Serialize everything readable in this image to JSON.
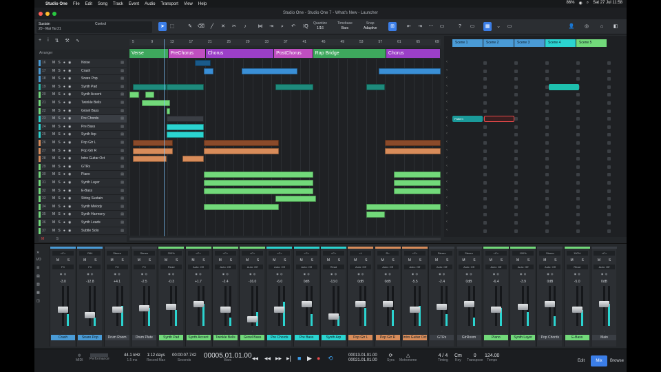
{
  "menubar": {
    "app": "Studio One",
    "items": [
      "File",
      "Edit",
      "Song",
      "Track",
      "Event",
      "Audio",
      "Transport",
      "View",
      "Help"
    ],
    "battery": "86%",
    "clock": "Sat 27 Jul 11:58"
  },
  "window_title": "Studio One - Studio One 7 - What's New - Launcher",
  "toolbar": {
    "preset": "Sustain",
    "preset_sub": "20 - Mai Tai 21",
    "control": "Control",
    "quantize_lbl": "Quantize",
    "quantize": "1/16",
    "timebase_lbl": "Timebase",
    "timebase": "Bars",
    "snap_lbl": "Snap",
    "snap": "Adaptive"
  },
  "arranger_label": "Arranger",
  "ruler": [
    "5",
    "9",
    "13",
    "17",
    "21",
    "25",
    "29",
    "33",
    "37",
    "41",
    "45",
    "49",
    "53",
    "57",
    "61",
    "65",
    "69"
  ],
  "sections": [
    {
      "name": "Verse",
      "color": "#3ea85d",
      "start": 0,
      "end": 12.5
    },
    {
      "name": "PreChorus",
      "color": "#c04fc0",
      "start": 12.5,
      "end": 24.5
    },
    {
      "name": "Chorus",
      "color": "#9b3fc7",
      "start": 24.5,
      "end": 46.5
    },
    {
      "name": "PostChorus",
      "color": "#c04fc0",
      "start": 46.5,
      "end": 59
    },
    {
      "name": "Rap Bridge",
      "color": "#3ea85d",
      "start": 59,
      "end": 82.5
    },
    {
      "name": "Chorus",
      "color": "#9b3fc7",
      "start": 82.5,
      "end": 100
    }
  ],
  "tracks": [
    {
      "n": "16",
      "name": "Noise",
      "color": "#4a9bd6"
    },
    {
      "n": "17",
      "name": "Crash",
      "color": "#4a9bd6"
    },
    {
      "n": "18",
      "name": "Snare Pop",
      "color": "#4a9bd6"
    },
    {
      "n": "19",
      "name": "Synth Pad",
      "color": "#2cb6a2"
    },
    {
      "n": "20",
      "name": "Synth Accent",
      "color": "#72d97a"
    },
    {
      "n": "21",
      "name": "Twinkle Bells",
      "color": "#72d97a"
    },
    {
      "n": "22",
      "name": "Growl Bass",
      "color": "#72d97a"
    },
    {
      "n": "23",
      "name": "Pre Chords",
      "color": "#2bd4d0"
    },
    {
      "n": "24",
      "name": "Pre Bass",
      "color": "#2bd4d0"
    },
    {
      "n": "25",
      "name": "Synth Arp",
      "color": "#2bd4d0"
    },
    {
      "n": "26",
      "name": "Pop Gtr L",
      "color": "#d88c5a"
    },
    {
      "n": "27",
      "name": "Pop Gtr R",
      "color": "#d88c5a"
    },
    {
      "n": "28",
      "name": "Intro Guitar Oct",
      "color": "#d88c5a"
    },
    {
      "n": "29",
      "name": "GTRs",
      "color": "#72d97a"
    },
    {
      "n": "30",
      "name": "Piano",
      "color": "#72d97a"
    },
    {
      "n": "31",
      "name": "Synth Layer",
      "color": "#72d97a"
    },
    {
      "n": "32",
      "name": "E-Bass",
      "color": "#72d97a"
    },
    {
      "n": "33",
      "name": "String Sustain",
      "color": "#72d97a"
    },
    {
      "n": "34",
      "name": "Synth Melody",
      "color": "#72d97a"
    },
    {
      "n": "35",
      "name": "Synth Harmony",
      "color": "#72d97a"
    },
    {
      "n": "36",
      "name": "Synth Leads",
      "color": "#72d97a"
    },
    {
      "n": "37",
      "name": "Subtle Solo",
      "color": "#72d97a"
    }
  ],
  "scenes": [
    {
      "name": "Scene 1",
      "color": "#4a9bd6"
    },
    {
      "name": "Scene 2",
      "color": "#4a9bd6"
    },
    {
      "name": "Scene 3",
      "color": "#4a9bd6"
    },
    {
      "name": "Scene 4",
      "color": "#2bd4d0"
    },
    {
      "name": "Scene 5",
      "color": "#72d97a"
    }
  ],
  "launcher_clip": "Pattern",
  "channels": [
    {
      "name": "Crash",
      "color": "#4a9bd6",
      "vol": "-3.0",
      "pan": "<C>",
      "route": "FX"
    },
    {
      "name": "Snare Pop",
      "color": "#4a9bd6",
      "vol": "-12.8",
      "pan": "R64",
      "route": "FX"
    },
    {
      "name": "Drum Room",
      "color": "#2c2f33",
      "vol": "+4.1",
      "pan": "Stereo",
      "route": "FX"
    },
    {
      "name": "Drum Plate",
      "color": "#2c2f33",
      "vol": "-2.5",
      "pan": "Stereo",
      "route": "FX"
    },
    {
      "name": "Synth Pad",
      "color": "#72d97a",
      "vol": "-0.3",
      "pan": "200%",
      "route": "Read"
    },
    {
      "name": "Synth Accent",
      "color": "#72d97a",
      "vol": "+1.7",
      "pan": "<C>",
      "route": "Auto: Off"
    },
    {
      "name": "Twinkle Bells",
      "color": "#72d97a",
      "vol": "-2.4",
      "pan": "<C>",
      "route": "Auto: Off"
    },
    {
      "name": "Growl Bass",
      "color": "#72d97a",
      "vol": "-16.0",
      "pan": "<C>",
      "route": "Auto: Off"
    },
    {
      "name": "Pre Chords",
      "color": "#2bd4d0",
      "vol": "-6.0",
      "pan": "<C>",
      "route": "Auto: Off"
    },
    {
      "name": "Pre Bass",
      "color": "#2bd4d0",
      "vol": "0dB",
      "pan": "<C>",
      "route": "Auto: Off"
    },
    {
      "name": "Synth Arp",
      "color": "#2bd4d0",
      "vol": "-13.0",
      "pan": "<C>",
      "route": "Read"
    },
    {
      "name": "Pop Gtr L",
      "color": "#d88c5a",
      "vol": "0dB",
      "pan": "<L",
      "route": "Auto: Off"
    },
    {
      "name": "Pop Gtr R",
      "color": "#d88c5a",
      "vol": "0dB",
      "pan": "R>",
      "route": "Auto: Off"
    },
    {
      "name": "Intro Guitar Oct",
      "color": "#d88c5a",
      "vol": "-5.5",
      "pan": "<C>",
      "route": "Auto: Off"
    },
    {
      "name": "GTRs",
      "color": "#2c2f33",
      "vol": "-2.4",
      "pan": "Stereo",
      "route": "Auto: Off"
    },
    {
      "name": "GtrRoom",
      "color": "#2c2f33",
      "vol": "0dB",
      "pan": "Stereo",
      "route": "Auto: Off"
    },
    {
      "name": "Piano",
      "color": "#72d97a",
      "vol": "-6.4",
      "pan": "<C>",
      "route": "Auto: Off"
    },
    {
      "name": "Synth Layer",
      "color": "#72d97a",
      "vol": "-3.9",
      "pan": "100%",
      "route": "Auto: Off"
    },
    {
      "name": "Pop Chords",
      "color": "#2c2f33",
      "vol": "0dB",
      "pan": "Stereo",
      "route": "Auto: Off"
    },
    {
      "name": "E-Bass",
      "color": "#72d97a",
      "vol": "-5.0",
      "pan": "100%",
      "route": "Read"
    },
    {
      "name": "Main",
      "color": "#2c2f33",
      "vol": "0dB",
      "pan": "<C>",
      "route": "Auto: Off"
    }
  ],
  "transport": {
    "midi": "MIDI",
    "performance": "Performance",
    "sample_rate": "44.1 kHz",
    "latency": "1.5 ms",
    "record_max": "1:12 days",
    "record_lbl": "Record Max",
    "seconds_val": "00:00:07.742",
    "seconds_lbl": "Seconds",
    "bars": "00005.01.01.00",
    "bars_lbl": "Bars",
    "loop_start": "00013.01.01.00",
    "loop_end": "00021.01.01.00",
    "sync": "Sync",
    "metronome": "Metronome",
    "timing": "4 / 4",
    "timing_lbl": "Timing",
    "key": "Cm",
    "key_lbl": "Key",
    "transpose": "0",
    "transpose_lbl": "Transpose",
    "tempo": "124.00",
    "tempo_lbl": "Tempo"
  },
  "nav": {
    "edit": "Edit",
    "mix": "Mix",
    "browse": "Browse"
  }
}
